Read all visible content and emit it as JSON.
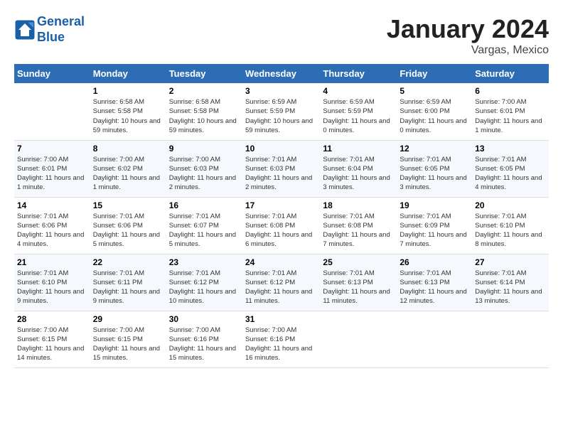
{
  "header": {
    "logo_line1": "General",
    "logo_line2": "Blue",
    "month_title": "January 2024",
    "location": "Vargas, Mexico"
  },
  "weekdays": [
    "Sunday",
    "Monday",
    "Tuesday",
    "Wednesday",
    "Thursday",
    "Friday",
    "Saturday"
  ],
  "rows": [
    [
      {
        "num": "",
        "info": ""
      },
      {
        "num": "1",
        "info": "Sunrise: 6:58 AM\nSunset: 5:58 PM\nDaylight: 10 hours\nand 59 minutes."
      },
      {
        "num": "2",
        "info": "Sunrise: 6:58 AM\nSunset: 5:58 PM\nDaylight: 10 hours\nand 59 minutes."
      },
      {
        "num": "3",
        "info": "Sunrise: 6:59 AM\nSunset: 5:59 PM\nDaylight: 10 hours\nand 59 minutes."
      },
      {
        "num": "4",
        "info": "Sunrise: 6:59 AM\nSunset: 5:59 PM\nDaylight: 11 hours\nand 0 minutes."
      },
      {
        "num": "5",
        "info": "Sunrise: 6:59 AM\nSunset: 6:00 PM\nDaylight: 11 hours\nand 0 minutes."
      },
      {
        "num": "6",
        "info": "Sunrise: 7:00 AM\nSunset: 6:01 PM\nDaylight: 11 hours\nand 1 minute."
      }
    ],
    [
      {
        "num": "7",
        "info": "Sunrise: 7:00 AM\nSunset: 6:01 PM\nDaylight: 11 hours\nand 1 minute."
      },
      {
        "num": "8",
        "info": "Sunrise: 7:00 AM\nSunset: 6:02 PM\nDaylight: 11 hours\nand 1 minute."
      },
      {
        "num": "9",
        "info": "Sunrise: 7:00 AM\nSunset: 6:03 PM\nDaylight: 11 hours\nand 2 minutes."
      },
      {
        "num": "10",
        "info": "Sunrise: 7:01 AM\nSunset: 6:03 PM\nDaylight: 11 hours\nand 2 minutes."
      },
      {
        "num": "11",
        "info": "Sunrise: 7:01 AM\nSunset: 6:04 PM\nDaylight: 11 hours\nand 3 minutes."
      },
      {
        "num": "12",
        "info": "Sunrise: 7:01 AM\nSunset: 6:05 PM\nDaylight: 11 hours\nand 3 minutes."
      },
      {
        "num": "13",
        "info": "Sunrise: 7:01 AM\nSunset: 6:05 PM\nDaylight: 11 hours\nand 4 minutes."
      }
    ],
    [
      {
        "num": "14",
        "info": "Sunrise: 7:01 AM\nSunset: 6:06 PM\nDaylight: 11 hours\nand 4 minutes."
      },
      {
        "num": "15",
        "info": "Sunrise: 7:01 AM\nSunset: 6:06 PM\nDaylight: 11 hours\nand 5 minutes."
      },
      {
        "num": "16",
        "info": "Sunrise: 7:01 AM\nSunset: 6:07 PM\nDaylight: 11 hours\nand 5 minutes."
      },
      {
        "num": "17",
        "info": "Sunrise: 7:01 AM\nSunset: 6:08 PM\nDaylight: 11 hours\nand 6 minutes."
      },
      {
        "num": "18",
        "info": "Sunrise: 7:01 AM\nSunset: 6:08 PM\nDaylight: 11 hours\nand 7 minutes."
      },
      {
        "num": "19",
        "info": "Sunrise: 7:01 AM\nSunset: 6:09 PM\nDaylight: 11 hours\nand 7 minutes."
      },
      {
        "num": "20",
        "info": "Sunrise: 7:01 AM\nSunset: 6:10 PM\nDaylight: 11 hours\nand 8 minutes."
      }
    ],
    [
      {
        "num": "21",
        "info": "Sunrise: 7:01 AM\nSunset: 6:10 PM\nDaylight: 11 hours\nand 9 minutes."
      },
      {
        "num": "22",
        "info": "Sunrise: 7:01 AM\nSunset: 6:11 PM\nDaylight: 11 hours\nand 9 minutes."
      },
      {
        "num": "23",
        "info": "Sunrise: 7:01 AM\nSunset: 6:12 PM\nDaylight: 11 hours\nand 10 minutes."
      },
      {
        "num": "24",
        "info": "Sunrise: 7:01 AM\nSunset: 6:12 PM\nDaylight: 11 hours\nand 11 minutes."
      },
      {
        "num": "25",
        "info": "Sunrise: 7:01 AM\nSunset: 6:13 PM\nDaylight: 11 hours\nand 11 minutes."
      },
      {
        "num": "26",
        "info": "Sunrise: 7:01 AM\nSunset: 6:13 PM\nDaylight: 11 hours\nand 12 minutes."
      },
      {
        "num": "27",
        "info": "Sunrise: 7:01 AM\nSunset: 6:14 PM\nDaylight: 11 hours\nand 13 minutes."
      }
    ],
    [
      {
        "num": "28",
        "info": "Sunrise: 7:00 AM\nSunset: 6:15 PM\nDaylight: 11 hours\nand 14 minutes."
      },
      {
        "num": "29",
        "info": "Sunrise: 7:00 AM\nSunset: 6:15 PM\nDaylight: 11 hours\nand 15 minutes."
      },
      {
        "num": "30",
        "info": "Sunrise: 7:00 AM\nSunset: 6:16 PM\nDaylight: 11 hours\nand 15 minutes."
      },
      {
        "num": "31",
        "info": "Sunrise: 7:00 AM\nSunset: 6:16 PM\nDaylight: 11 hours\nand 16 minutes."
      },
      {
        "num": "",
        "info": ""
      },
      {
        "num": "",
        "info": ""
      },
      {
        "num": "",
        "info": ""
      }
    ]
  ]
}
